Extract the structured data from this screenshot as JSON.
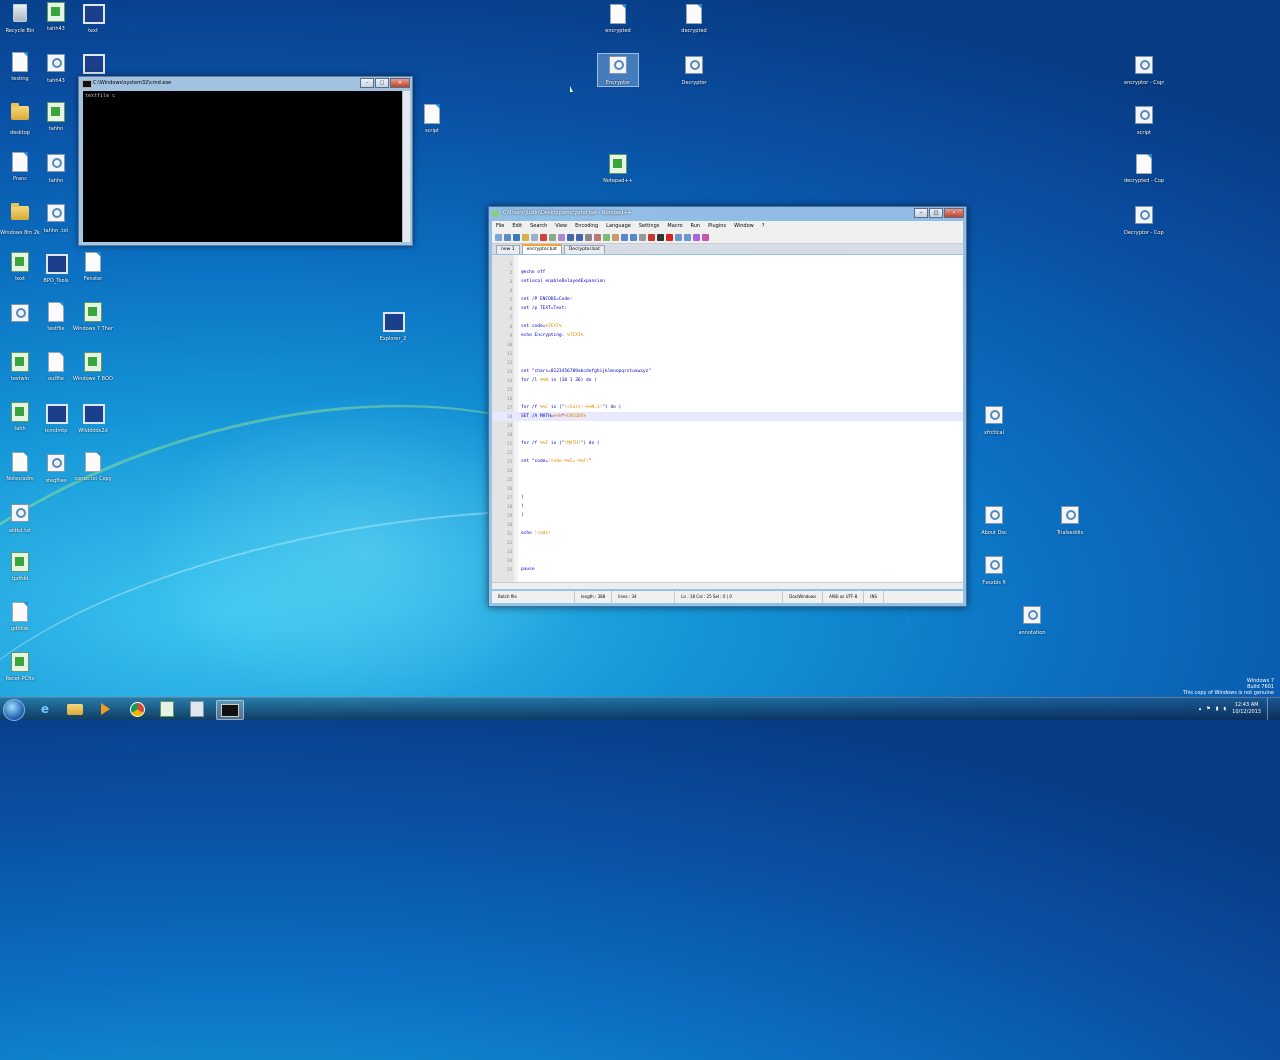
{
  "desktop": {
    "icons": [
      {
        "label": "Recycle Bin",
        "type": "bin"
      },
      {
        "label": "tahh43",
        "type": "green"
      },
      {
        "label": "text",
        "type": "monitor"
      },
      {
        "label": "testing",
        "type": "doc"
      },
      {
        "label": "tahh43",
        "type": "magn"
      },
      {
        "label": "",
        "type": "monitor"
      },
      {
        "label": "desktop",
        "type": "folder"
      },
      {
        "label": "tahhn",
        "type": "green"
      },
      {
        "label": "Pranc",
        "type": "doc"
      },
      {
        "label": "tahhn",
        "type": "magn"
      },
      {
        "label": "Windows 8m 2k",
        "type": "folder"
      },
      {
        "label": "tahhn .txt",
        "type": "magn"
      },
      {
        "label": "text",
        "type": "green"
      },
      {
        "label": "BPO_Tools",
        "type": "monitor"
      },
      {
        "label": "Fenster",
        "type": "doc"
      },
      {
        "label": "",
        "type": "magn"
      },
      {
        "label": "testfile",
        "type": "doc"
      },
      {
        "label": "Windows 7 Themes",
        "type": "green"
      },
      {
        "label": "testwin",
        "type": "green"
      },
      {
        "label": "outfile",
        "type": "doc"
      },
      {
        "label": "Windows 7 BOOMstl",
        "type": "green"
      },
      {
        "label": "tahh",
        "type": "green"
      },
      {
        "label": "tcmdmtp",
        "type": "monitor"
      },
      {
        "label": "Wlidddds2d",
        "type": "monitor"
      },
      {
        "label": "Notes/adm",
        "type": "doc"
      },
      {
        "label": "stegfiles",
        "type": "magn"
      },
      {
        "label": "conso.txt Copy",
        "type": "doc"
      },
      {
        "label": "aldkd.txt",
        "type": "magn"
      },
      {
        "label": "tpdfdd",
        "type": "green"
      },
      {
        "label": "gdfdisk",
        "type": "doc"
      },
      {
        "label": "Recet-PCfix",
        "type": "green"
      },
      {
        "label": "encrypted",
        "type": "doc"
      },
      {
        "label": "decrypted",
        "type": "doc"
      },
      {
        "label": "Encryptor",
        "type": "magn"
      },
      {
        "label": "Decryptor",
        "type": "magn"
      },
      {
        "label": "script",
        "type": "doc"
      },
      {
        "label": "Notepad++",
        "type": "green"
      },
      {
        "label": "Explorer_2",
        "type": "monitor"
      },
      {
        "label": "encryptor - Copy",
        "type": "magn"
      },
      {
        "label": "script",
        "type": "magn"
      },
      {
        "label": "decrypted - Copy",
        "type": "doc"
      },
      {
        "label": "Decryptor - Copy",
        "type": "magn"
      },
      {
        "label": "xfrctlcal",
        "type": "magn"
      },
      {
        "label": "About Dsc",
        "type": "magn"
      },
      {
        "label": "Trialseddix",
        "type": "magn"
      },
      {
        "label": "Fxsxbis fi",
        "type": "magn"
      },
      {
        "label": "annotation",
        "type": "magn"
      }
    ]
  },
  "console": {
    "title": "C:\\Windows\\system32\\cmd.exe",
    "text": "textfile c"
  },
  "notepad": {
    "title": "C:\\Users\\Justin\\Desktop\\encryptor.bat - Notepad++",
    "menu": [
      "File",
      "Edit",
      "Search",
      "View",
      "Encoding",
      "Language",
      "Settings",
      "Macro",
      "Run",
      "Plugins",
      "Window",
      "?"
    ],
    "tabs": [
      "new 1",
      "encryptor.bat",
      "Decryptor.bat"
    ],
    "active_tab": 1,
    "lines": [
      "",
      "@echo off",
      "setlocal enableDelayedExpansion",
      "",
      "set /P ENCODE=Code:",
      "set /p TEXT=Text:",
      "",
      "set code=%TEXT%",
      "echo Encrypting: %TEXT%",
      "",
      "",
      "",
      "set \"chars=0123456789abcdefghijklmnopqrstuvwxyz\"",
      "for /l %%N in (10 1 36) do (",
      "",
      "",
      "for /f %%C in (\"!chars:~%%N,1!\") do (",
      "SET /A MATH=%%N*%ENCODE%",
      "",
      "",
      "for /f %%F in (\"!MATH!\") do (",
      "",
      "set \"code=!code:%%C=-%%F!\"",
      "",
      "",
      "",
      ")",
      ")",
      ")",
      "",
      "echo !code!",
      "",
      "",
      "",
      "pause"
    ],
    "current_line": 18,
    "status": {
      "type": "Batch file",
      "length": "length : 388",
      "lines": "lines : 34",
      "pos": "Ln : 18   Col : 25   Sel : 0 | 0",
      "eol": "Dos\\Windows",
      "enc": "ANSI as UTF-8",
      "mode": "INS"
    }
  },
  "taskbar": {
    "clock_time": "12:43 AM",
    "clock_date": "10/12/2013",
    "watermark": [
      "Windows 7",
      "Build 7601",
      "This copy of Windows is not genuine"
    ]
  },
  "colors": {
    "accent": "#1596d8",
    "code_keyword": "#0000c8",
    "code_var": "#e08a00"
  }
}
